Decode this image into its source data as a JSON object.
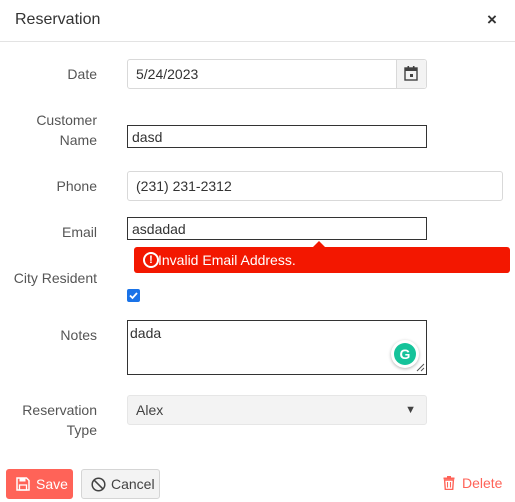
{
  "dialog": {
    "title": "Reservation",
    "close_symbol": "×"
  },
  "form": {
    "date": {
      "label": "Date",
      "value": "5/24/2023"
    },
    "customer_name": {
      "label_line1": "Customer",
      "label_line2": "Name",
      "value": "dasd"
    },
    "phone": {
      "label": "Phone",
      "value": "(231) 231-2312"
    },
    "email": {
      "label": "Email",
      "value": "asdadad",
      "error": "Invalid Email Address."
    },
    "city_resident": {
      "label": "City Resident",
      "checked": true
    },
    "notes": {
      "label": "Notes",
      "value": "dada"
    },
    "reservation_type": {
      "label_line1": "Reservation",
      "label_line2": "Type",
      "value": "Alex"
    }
  },
  "actions": {
    "save": "Save",
    "cancel": "Cancel",
    "delete": "Delete"
  },
  "icons": {
    "calendar": "calendar-icon",
    "error": "exclamation-circle-icon",
    "save": "floppy-disk-icon",
    "cancel": "cancel-circle-icon",
    "delete": "trash-icon",
    "grammarly": "grammarly-icon",
    "dropdown": "caret-down-icon"
  },
  "colors": {
    "primary": "#ff6358",
    "error": "#f31700",
    "checkbox": "#1a73e8",
    "grammarly": "#15c39a"
  }
}
